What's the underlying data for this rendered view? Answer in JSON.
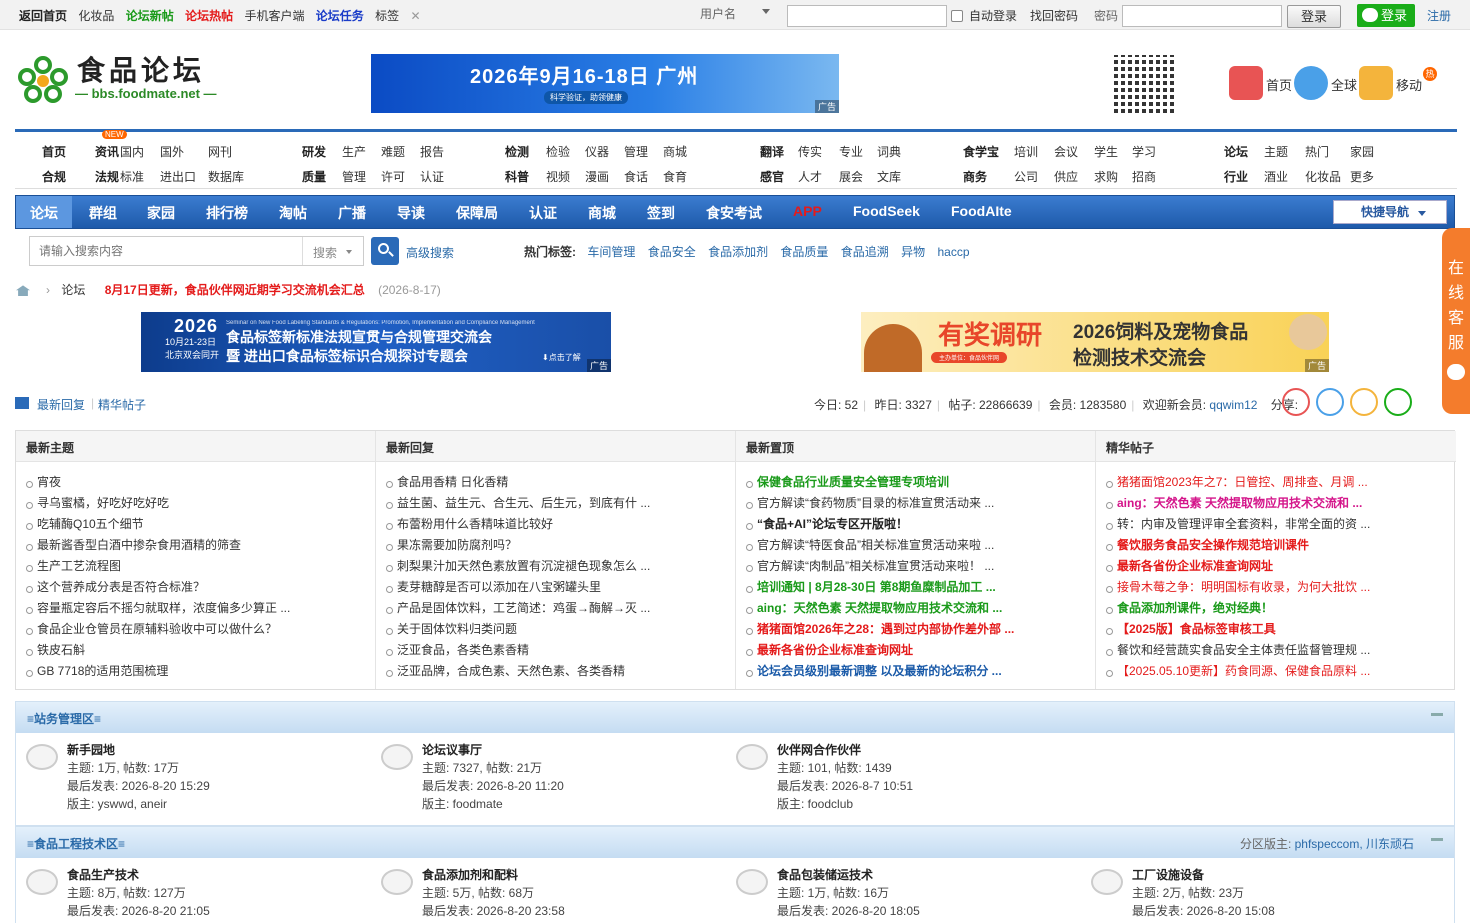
{
  "topbar": {
    "links": [
      "返回首页",
      "化妆品",
      "论坛新帖",
      "论坛热帖",
      "手机客户端",
      "论坛任务",
      "标签"
    ],
    "user_label": "用户名",
    "auto_login": "自动登录",
    "find_pwd": "找回密码",
    "pwd_label": "密码",
    "login_btn": "登录",
    "wx_login": "登录",
    "register": "注册"
  },
  "logo": {
    "cn": "食品论坛",
    "en": "— bbs.foodmate.net —"
  },
  "banner1": {
    "title": "2026年9月16-18日 广州",
    "sub": "科学验证，助领健康",
    "ad": "广告"
  },
  "quick_links": [
    {
      "label": "首页",
      "icon": "home-icon"
    },
    {
      "label": "全球",
      "icon": "globe-icon"
    },
    {
      "label": "移动",
      "icon": "mobile-icon"
    }
  ],
  "hot_badge": "热",
  "nav_rows": [
    [
      "首页",
      "资讯",
      "国内",
      "国外",
      "网刊",
      "研发",
      "生产",
      "难题",
      "报告",
      "检测",
      "检验",
      "仪器",
      "管理",
      "商城",
      "翻译",
      "传实",
      "专业",
      "词典",
      "食学宝",
      "培训",
      "会议",
      "学生",
      "学习",
      "论坛",
      "主题",
      "热门",
      "家园"
    ],
    [
      "合规",
      "法规",
      "标准",
      "进出口",
      "数据库",
      "质量",
      "管理",
      "许可",
      "认证",
      "科普",
      "视频",
      "漫画",
      "食话",
      "食育",
      "感官",
      "人才",
      "展会",
      "文库",
      "商务",
      "公司",
      "供应",
      "求购",
      "招商",
      "行业",
      "酒业",
      "化妆品",
      "更多"
    ]
  ],
  "new_badge": "NEW",
  "blue_nav": [
    "论坛",
    "群组",
    "家园",
    "排行榜",
    "淘帖",
    "广播",
    "导读",
    "保障局",
    "认证",
    "商城",
    "签到",
    "食安考试",
    "APP",
    "FoodSeek",
    "FoodAIte"
  ],
  "quick_nav": "快捷导航",
  "search": {
    "placeholder": "请输入搜索内容",
    "type": "搜索",
    "advanced": "高级搜索"
  },
  "hot_tags": {
    "label": "热门标签:",
    "tags": [
      "车间管理",
      "食品安全",
      "食品添加剂",
      "食品质量",
      "食品追溯",
      "异物",
      "haccp"
    ]
  },
  "breadcrumb": {
    "forum": "论坛",
    "title": "8月17日更新，食品伙伴网近期学习交流机会汇总",
    "date": "(2026-8-17)"
  },
  "banner2": {
    "year": "2026",
    "date1": "10月21-23日",
    "date2": "北京双会同开",
    "line1": "食品标签新标准法规宣贯与合规管理交流会",
    "line2": "暨 进出口食品标签标识合规探讨专题会",
    "small": "Seminar on New Food Labeling Standards & Regulations: Promotion, Implementation and Compliance Management",
    "click": "⬇点击了解",
    "ad": "广告"
  },
  "banner3": {
    "c1": "有奖调研",
    "c2": "2026饲料及宠物食品",
    "c3": "检测技术交流会",
    "org": "主办单位：食品伙伴网",
    "ad": "广告"
  },
  "stats": {
    "latest_reply": "最新回复",
    "digest": "精华帖子",
    "today": "今日: 52",
    "yesterday": "昨日: 3327",
    "posts": "帖子: 22866639",
    "members": "会员: 1283580",
    "welcome": "欢迎新会员:",
    "new_member": "qqwim12",
    "share": "分享:"
  },
  "panels": [
    {
      "title": "最新主题",
      "items": [
        {
          "t": "宵夜",
          "c": ""
        },
        {
          "t": "寻乌蜜橘，好吃好吃好吃",
          "c": ""
        },
        {
          "t": "吃辅酶Q10五个细节",
          "c": ""
        },
        {
          "t": "最新酱香型白酒中掺杂食用酒精的筛查",
          "c": ""
        },
        {
          "t": "生产工艺流程图",
          "c": ""
        },
        {
          "t": "这个营养成分表是否符合标准？",
          "c": ""
        },
        {
          "t": "容量瓶定容后不摇匀就取样，浓度偏多少算正 ...",
          "c": ""
        },
        {
          "t": "食品企业仓管员在原辅料验收中可以做什么？",
          "c": ""
        },
        {
          "t": "铁皮石斛",
          "c": ""
        },
        {
          "t": "GB 7718的适用范围梳理",
          "c": ""
        }
      ]
    },
    {
      "title": "最新回复",
      "items": [
        {
          "t": "食品用香精 日化香精",
          "c": ""
        },
        {
          "t": "益生菌、益生元、合生元、后生元，到底有什 ...",
          "c": ""
        },
        {
          "t": "布蕾粉用什么香精味道比较好",
          "c": ""
        },
        {
          "t": "果冻需要加防腐剂吗？",
          "c": ""
        },
        {
          "t": "刺梨果汁加天然色素放置有沉淀褪色现象怎么 ...",
          "c": ""
        },
        {
          "t": "麦芽糖醇是否可以添加在八宝粥罐头里",
          "c": ""
        },
        {
          "t": "产品是固体饮料，工艺简述：鸡蛋→酶解→灭 ...",
          "c": ""
        },
        {
          "t": "关于固体饮料归类问题",
          "c": ""
        },
        {
          "t": "泛亚食品，各类色素香精",
          "c": ""
        },
        {
          "t": "泛亚品牌，合成色素、天然色素、各类香精",
          "c": ""
        }
      ]
    },
    {
      "title": "最新置顶",
      "items": [
        {
          "t": "保健食品行业质量安全管理专项培训",
          "c": "g"
        },
        {
          "t": "官方解读“食药物质”目录的标准宣贯活动来 ...",
          "c": ""
        },
        {
          "t": "“食品+AI”论坛专区开版啦！",
          "c": "k"
        },
        {
          "t": "官方解读“特医食品”相关标准宣贯活动来啦 ...",
          "c": ""
        },
        {
          "t": "官方解读“肉制品”相关标准宣贯活动来啦！ ...",
          "c": ""
        },
        {
          "t": "培训通知 | 8月28-30日 第8期鱼糜制品加工 ...",
          "c": "g"
        },
        {
          "t": "aing：天然色素 天然提取物应用技术交流和 ...",
          "c": "g"
        },
        {
          "t": "猪猪面馆2026年之28：遇到过内部协作差外部 ...",
          "c": "r"
        },
        {
          "t": "最新各省份企业标准查询网址",
          "c": "r"
        },
        {
          "t": "论坛会员级别最新调整 以及最新的论坛积分 ...",
          "c": "bl"
        }
      ]
    },
    {
      "title": "精华帖子",
      "items": [
        {
          "t": "猪猪面馆2023年之7：日管控、周排查、月调 ...",
          "c": "rr"
        },
        {
          "t": "aing：天然色素 天然提取物应用技术交流和 ...",
          "c": "m"
        },
        {
          "t": "转：内审及管理评审全套资料，非常全面的资 ...",
          "c": ""
        },
        {
          "t": "餐饮服务食品安全操作规范培训课件",
          "c": "r"
        },
        {
          "t": "最新各省份企业标准查询网址",
          "c": "r"
        },
        {
          "t": "接骨木莓之争：明明国标有收录，为何大批饮 ...",
          "c": "rr"
        },
        {
          "t": "食品添加剂课件，绝对经典！",
          "c": "g"
        },
        {
          "t": "【2025版】食品标签审核工具",
          "c": "r"
        },
        {
          "t": "餐饮和经营蔬实食品安全主体责任监督管理规 ...",
          "c": ""
        },
        {
          "t": "【2025.05.10更新】药食同源、保健食品原料 ...",
          "c": "rr"
        }
      ]
    }
  ],
  "sections": [
    {
      "title": "≡站务管理区≡",
      "mods_label": "",
      "mods": "",
      "forums": [
        {
          "name": "新手园地",
          "stat": "主题: 1万, 帖数: 17万",
          "last": "最后发表: 2026-8-20 15:29",
          "mod": "版主: yswwd, aneir"
        },
        {
          "name": "论坛议事厅",
          "stat": "主题: 7327, 帖数: 21万",
          "last": "最后发表: 2026-8-20 11:20",
          "mod": "版主: foodmate"
        },
        {
          "name": "伙伴网合作伙伴",
          "stat": "主题: 101, 帖数: 1439",
          "last": "最后发表: 2026-8-7 10:51",
          "mod": "版主: foodclub"
        }
      ]
    },
    {
      "title": "≡食品工程技术区≡",
      "mods_label": "分区版主:",
      "mods": "phfspeccom, 川东顽石",
      "forums": [
        {
          "name": "食品生产技术",
          "stat": "主题: 8万, 帖数: 127万",
          "last": "最后发表: 2026-8-20 21:05",
          "mod": ""
        },
        {
          "name": "食品添加剂和配料",
          "stat": "主题: 5万, 帖数: 68万",
          "last": "最后发表: 2026-8-20 23:58",
          "mod": ""
        },
        {
          "name": "食品包装储运技术",
          "stat": "主题: 1万, 帖数: 16万",
          "last": "最后发表: 2026-8-20 18:05",
          "mod": ""
        },
        {
          "name": "工厂设施设备",
          "stat": "主题: 2万, 帖数: 23万",
          "last": "最后发表: 2026-8-20 15:08",
          "mod": ""
        }
      ]
    }
  ],
  "side_service": "在线客服"
}
